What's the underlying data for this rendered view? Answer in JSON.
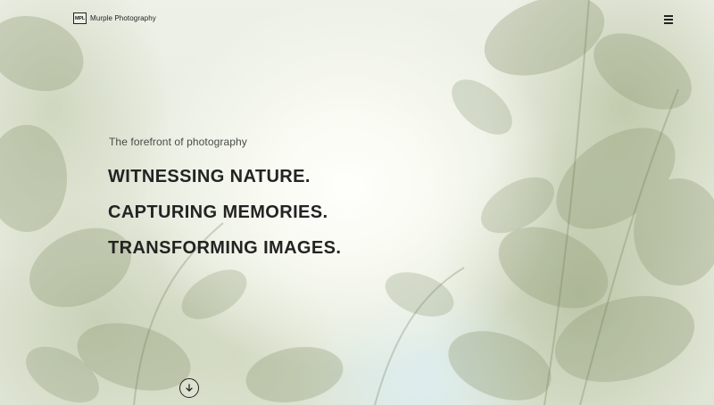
{
  "brand": {
    "logo_text": "MPL",
    "name": "Murple Photography"
  },
  "nav": {
    "menu_icon": "hamburger-menu-icon"
  },
  "hero": {
    "tagline": "The forefront of photography",
    "headlines": [
      "WITNESSING NATURE.",
      "CAPTURING MEMORIES.",
      "TRANSFORMING IMAGES."
    ],
    "scroll_icon": "arrow-down-circle-icon"
  },
  "colors": {
    "text_dark": "#232323",
    "tagline": "#4a4a48",
    "background_light": "#eef1e8"
  }
}
